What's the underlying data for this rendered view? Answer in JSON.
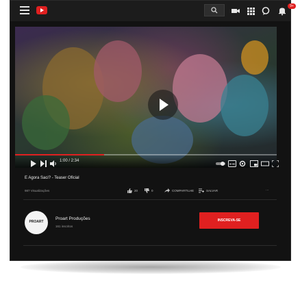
{
  "video": {
    "title": "E Agora Saci? - Teaser Oficial",
    "views": "987 Visualizações",
    "time": "1:00 / 2:34",
    "progress_fraction": 0.34
  },
  "actions": {
    "like_count": "20",
    "dislike_count": "0",
    "share_label": "COMPARTILHE",
    "save_label": "SALVAR",
    "more_label": "···"
  },
  "channel": {
    "avatar_text": "PROART",
    "name": "Proart Produções",
    "subscribers": "161 inscritos"
  },
  "subscribe_label": "INSCREVA-SE",
  "notifications": {
    "count": "9+"
  },
  "colors": {
    "accent": "#e02020",
    "background": "#121212",
    "topbar": "#1c1c1c"
  }
}
